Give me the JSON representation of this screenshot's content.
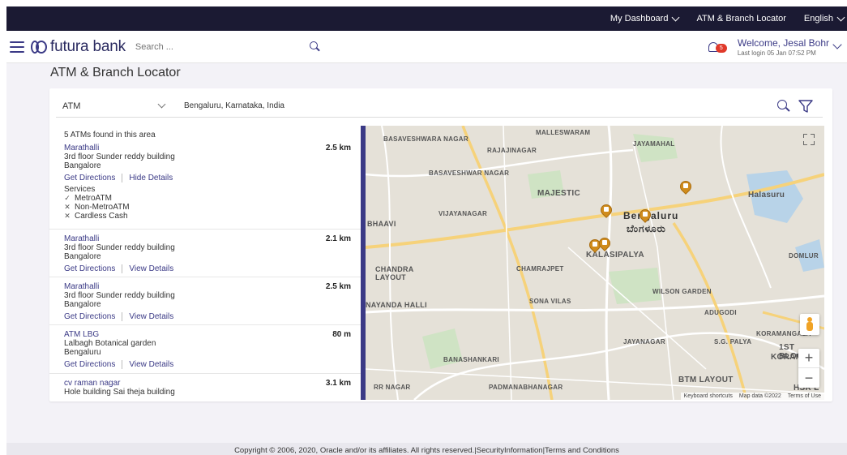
{
  "topbar": {
    "dashboard": "My Dashboard",
    "locator": "ATM & Branch Locator",
    "language": "English"
  },
  "header": {
    "brand": "futura bank",
    "search_placeholder": "Search ...",
    "notification_count": "5",
    "welcome": "Welcome, Jesal Bohr",
    "last_login": "Last login 05 Jan 07:52 PM"
  },
  "page": {
    "title": "ATM & Branch Locator"
  },
  "filter": {
    "type": "ATM",
    "location": "Bengaluru, Karnataka, India"
  },
  "results": {
    "found_text": "5 ATMs found in this area",
    "items": [
      {
        "name": "Marathalli",
        "distance": "2.5 km",
        "address1": "3rd floor Sunder reddy building",
        "address2": "Bangalore",
        "directions": "Get Directions",
        "details": "Hide Details",
        "services_label": "Services",
        "services": [
          {
            "mark": "✓",
            "label": "MetroATM"
          },
          {
            "mark": "✕",
            "label": "Non-MetroATM"
          },
          {
            "mark": "✕",
            "label": "Cardless Cash"
          }
        ]
      },
      {
        "name": "Marathalli",
        "distance": "2.1 km",
        "address1": "3rd floor Sunder reddy building",
        "address2": "Bangalore",
        "directions": "Get Directions",
        "details": "View Details"
      },
      {
        "name": "Marathalli",
        "distance": "2.5 km",
        "address1": "3rd floor Sunder reddy building",
        "address2": "Bangalore",
        "directions": "Get Directions",
        "details": "View Details"
      },
      {
        "name": "ATM LBG",
        "distance": "80 m",
        "address1": "Lalbagh Botanical garden",
        "address2": "Bengaluru",
        "directions": "Get Directions",
        "details": "View Details"
      },
      {
        "name": "cv raman nagar",
        "distance": "3.1 km",
        "address1": "Hole building Sai theja building"
      }
    ]
  },
  "map": {
    "labels": {
      "malleswaram": "MALLESWARAM",
      "basaveshwara_nagar": "BASAVESHWARA NAGAR",
      "rajajinagar": "RAJAJINAGAR",
      "jayamahal": "JAYAMAHAL",
      "basaveshwar_nagar": "BASAVESHWAR NAGAR",
      "halasuru": "Halasuru",
      "majestic": "MAJESTIC",
      "vijayanagar": "VIJAYANAGAR",
      "bengaluru": "Bengaluru",
      "bengaluru_kn": "ಬೆಂಗಳೂರು",
      "bhaavi": "BHAAVI",
      "kalasipalya": "KALASIPALYA",
      "domlur": "DOMLUR",
      "chandra_layout": "CHANDRA LAYOUT",
      "chamrajpet": "CHAMRAJPET",
      "wilson_garden": "WILSON GARDEN",
      "nayanda_halli": "NAYANDA HALLI",
      "sona_vilas": "SONA VILAS",
      "adugodi": "ADUGODI",
      "koramangala": "KORAMANGALA",
      "jayanagar": "JAYANAGAR",
      "sg_palya": "S.G. PALYA",
      "first_block": "1ST BLOCK",
      "koram": "KORAM",
      "banashankari": "BANASHANKARI",
      "btm_layout": "BTM LAYOUT",
      "rr_nagar": "RR NAGAR",
      "padmanabhanagar": "PADMANABHANAGAR",
      "hsr": "HSR L"
    },
    "zoom_in": "+",
    "zoom_out": "−",
    "attribution": {
      "shortcuts": "Keyboard shortcuts",
      "data": "Map data ©2022",
      "terms": "Terms of Use"
    }
  },
  "footer": {
    "text": "Copyright © 2006, 2020, Oracle and/or its affiliates. All rights reserved.|SecurityInformation|Terms and Conditions"
  },
  "colors": {
    "topbar": "#1b1a33",
    "brand": "#3b3a86",
    "pin": "#d08c1c",
    "badge": "#e0392a"
  }
}
